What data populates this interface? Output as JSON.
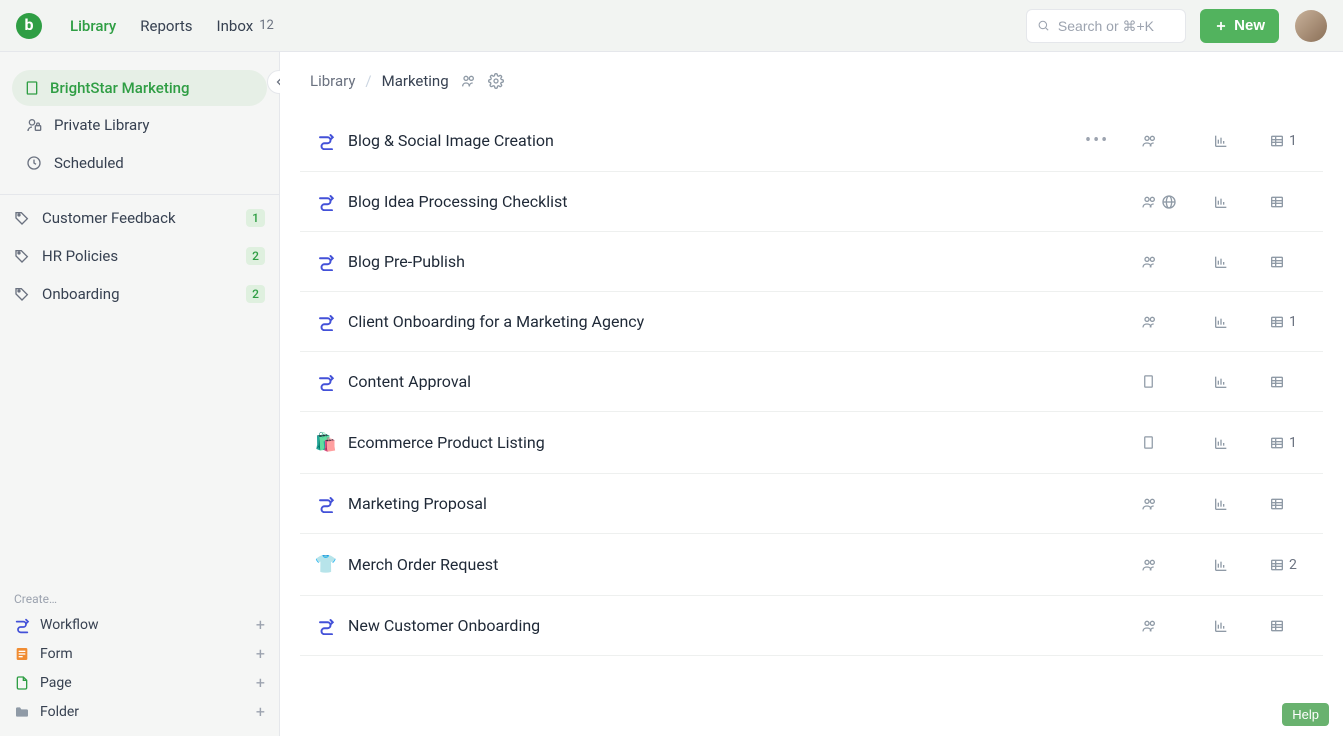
{
  "header": {
    "nav": [
      {
        "label": "Library",
        "active": true
      },
      {
        "label": "Reports",
        "active": false
      },
      {
        "label": "Inbox",
        "active": false,
        "count": "12"
      }
    ],
    "search_placeholder": "Search or ⌘+K",
    "new_button": "New"
  },
  "sidebar": {
    "org": "BrightStar Marketing",
    "private_library": "Private Library",
    "scheduled": "Scheduled",
    "tags": [
      {
        "label": "Customer Feedback",
        "count": "1"
      },
      {
        "label": "HR Policies",
        "count": "2"
      },
      {
        "label": "Onboarding",
        "count": "2"
      }
    ],
    "create_title": "Create…",
    "create_items": [
      {
        "label": "Workflow",
        "icon": "workflow",
        "color": "#4351d8"
      },
      {
        "label": "Form",
        "icon": "form",
        "color": "#f08c32"
      },
      {
        "label": "Page",
        "icon": "page",
        "color": "#2f9e44"
      },
      {
        "label": "Folder",
        "icon": "folder",
        "color": "#8f9aa6"
      }
    ]
  },
  "breadcrumb": {
    "root": "Library",
    "current": "Marketing"
  },
  "rows": [
    {
      "icon": "workflow",
      "title": "Blog & Social Image Creation",
      "share": "group",
      "globe": false,
      "table_count": "1",
      "show_more": true
    },
    {
      "icon": "workflow",
      "title": "Blog Idea Processing Checklist",
      "share": "group",
      "globe": true,
      "table_count": "",
      "show_more": false
    },
    {
      "icon": "workflow",
      "title": "Blog Pre-Publish",
      "share": "group",
      "globe": false,
      "table_count": "",
      "show_more": false
    },
    {
      "icon": "workflow",
      "title": "Client Onboarding for a Marketing Agency",
      "share": "group",
      "globe": false,
      "table_count": "1",
      "show_more": false
    },
    {
      "icon": "workflow",
      "title": "Content Approval",
      "share": "building",
      "globe": false,
      "table_count": "",
      "show_more": false
    },
    {
      "icon": "bags",
      "title": "Ecommerce Product Listing",
      "share": "building",
      "globe": false,
      "table_count": "1",
      "show_more": false
    },
    {
      "icon": "workflow",
      "title": "Marketing Proposal",
      "share": "group",
      "globe": false,
      "table_count": "",
      "show_more": false
    },
    {
      "icon": "shirt",
      "title": "Merch Order Request",
      "share": "group",
      "globe": false,
      "table_count": "2",
      "show_more": false
    },
    {
      "icon": "workflow",
      "title": "New Customer Onboarding",
      "share": "group",
      "globe": false,
      "table_count": "",
      "show_more": false
    }
  ],
  "help_label": "Help"
}
